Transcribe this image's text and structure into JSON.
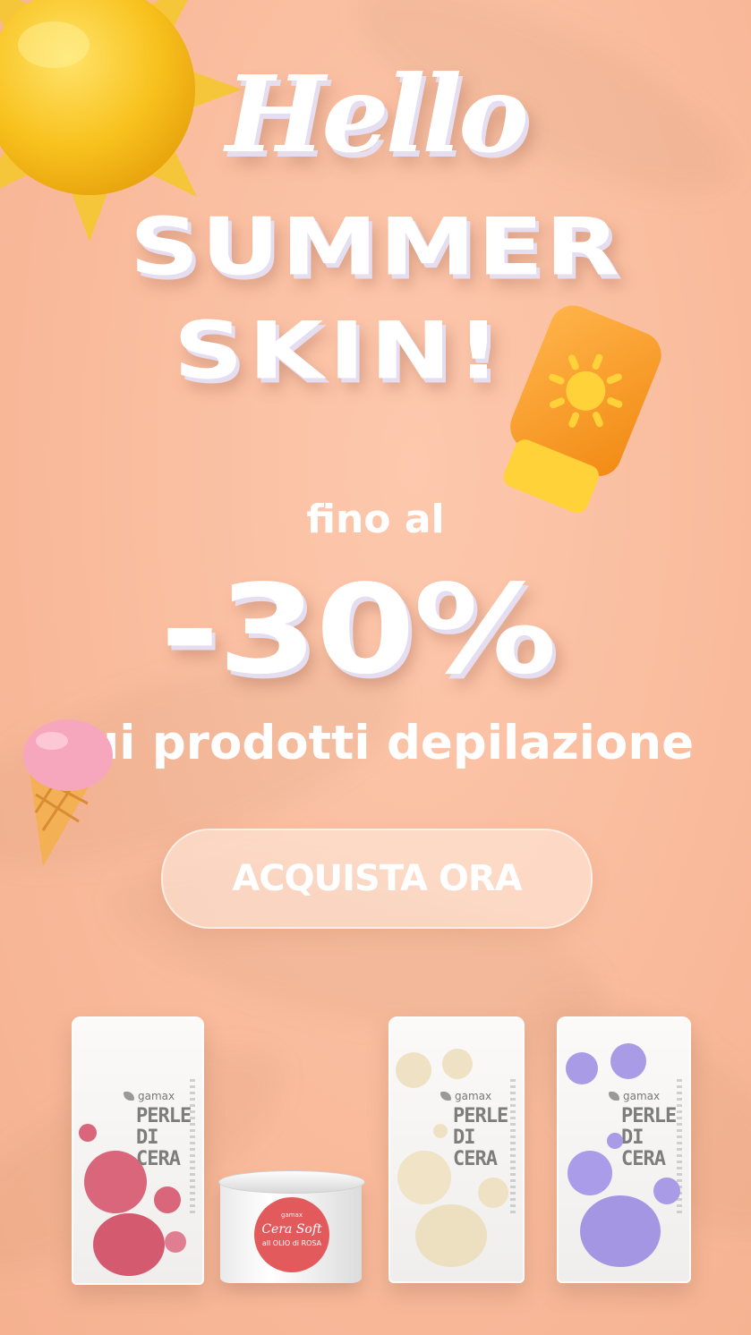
{
  "hero": {
    "hello": "Hello",
    "line1": "SUMMER",
    "line2": "SKIN!"
  },
  "offer": {
    "prefix": "fino al",
    "discount": "-30%",
    "suffix": "sui prodotti depilazione"
  },
  "cta": {
    "label": "ACQUISTA ORA"
  },
  "products": [
    {
      "brand": "gamax",
      "name_line1": "PERLE",
      "name_line2": "DI CERA",
      "color": "#d9667a"
    },
    {
      "brand": "gamax",
      "name": "Cera Soft",
      "desc": "all OLIO di ROSA",
      "color": "#e35a5c"
    },
    {
      "brand": "gamax",
      "name_line1": "PERLE",
      "name_line2": "DI CERA",
      "color": "#efe2c4"
    },
    {
      "brand": "gamax",
      "name_line1": "PERLE",
      "name_line2": "DI CERA",
      "color": "#a99be6"
    }
  ],
  "decor": {
    "icons": [
      "sun-icon",
      "sunscreen-icon",
      "ice-cream-icon"
    ],
    "background": "#f9bb9c"
  }
}
